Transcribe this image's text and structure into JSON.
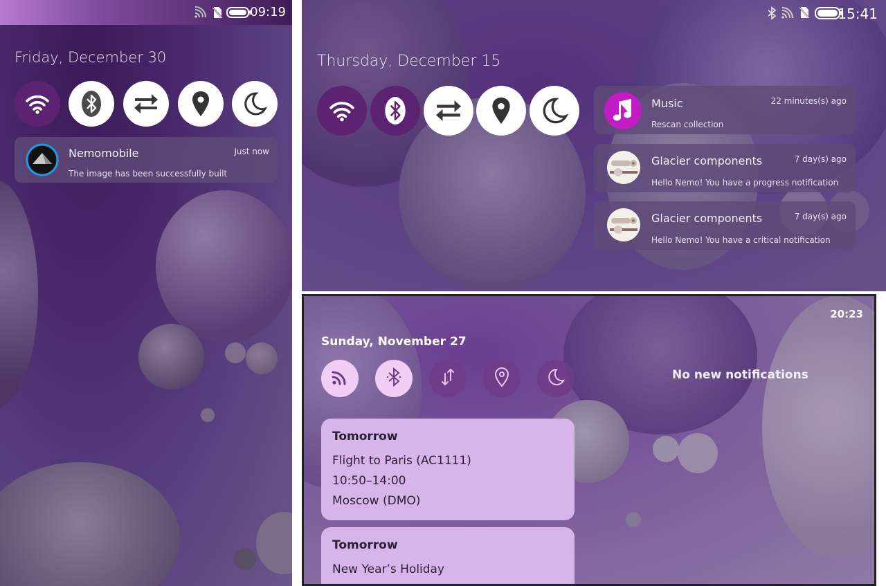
{
  "panel1": {
    "status_time": "09:19",
    "date": "Friday, December 30",
    "quick_settings": [
      {
        "icon": "wifi-icon",
        "active": false
      },
      {
        "icon": "bluetooth-icon",
        "active": true
      },
      {
        "icon": "data-transfer-icon",
        "active": true
      },
      {
        "icon": "location-icon",
        "active": true
      },
      {
        "icon": "night-mode-icon",
        "active": true
      }
    ],
    "notification": {
      "app": "Nemomobile",
      "time": "Just now",
      "body": "The image has been successfully built",
      "icon": "nemomobile-logo-icon"
    }
  },
  "panel2": {
    "status_time": "15:41",
    "date": "Thursday, December 15",
    "quick_settings": [
      {
        "icon": "wifi-icon",
        "active": false
      },
      {
        "icon": "bluetooth-icon",
        "active": false
      },
      {
        "icon": "data-transfer-icon",
        "active": true
      },
      {
        "icon": "location-icon",
        "active": true
      },
      {
        "icon": "night-mode-icon",
        "active": true
      }
    ],
    "notifications": [
      {
        "app": "Music",
        "time": "22 minutes(s) ago",
        "body": "Rescan collection",
        "icon": "music-note-icon"
      },
      {
        "app": "Glacier components",
        "time": "7 day(s) ago",
        "body": "Hello Nemo! You have a progress notification",
        "icon": "glacier-components-icon"
      },
      {
        "app": "Glacier components",
        "time": "7 day(s) ago",
        "body": "Hello Nemo! You have a critical notification",
        "icon": "glacier-components-icon"
      }
    ]
  },
  "panel3": {
    "status_time": "20:23",
    "date": "Sunday, November 27",
    "empty_text": "No new notifications",
    "quick_settings": [
      {
        "icon": "rss-wifi-icon",
        "active": true
      },
      {
        "icon": "bluetooth-icon",
        "active": true
      },
      {
        "icon": "data-transfer-icon",
        "active": false
      },
      {
        "icon": "location-icon",
        "active": false
      },
      {
        "icon": "night-mode-icon",
        "active": false
      }
    ],
    "events": [
      {
        "when": "Tomorrow",
        "title": "Flight to Paris (AC1111)",
        "time": "10:50–14:00",
        "place": "Moscow (DMO)"
      },
      {
        "when": "Tomorrow",
        "title": "New Year’s Holiday"
      }
    ]
  },
  "colors": {
    "toggle_on": "#ffffff",
    "toggle_off": "#5c2372",
    "panel3_toggle_on": "#f2cdf6",
    "music_icon": "#c21cc4",
    "card_bg": "#d7b5eb"
  }
}
